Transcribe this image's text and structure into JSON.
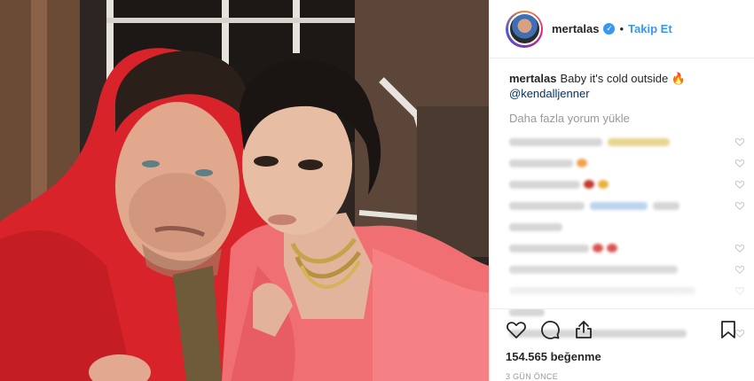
{
  "post": {
    "username": "mertalas",
    "verified_icon": "verified-check-icon",
    "separator": "•",
    "follow_label": "Takip Et",
    "caption_user": "mertalas",
    "caption_text": "Baby it's cold outside 🔥",
    "caption_mention": "@kendalljenner",
    "load_more_label": "Daha fazla yorum yükle",
    "likes": "154.565 beğenme",
    "time": "3 GÜN ÖNCE"
  },
  "icons": {
    "like": "heart-icon",
    "comment": "comment-icon",
    "share": "share-icon",
    "save": "bookmark-icon"
  },
  "colors": {
    "accent": "#3897f0",
    "mention": "#003569",
    "muted": "#999999",
    "border": "#efefef"
  }
}
